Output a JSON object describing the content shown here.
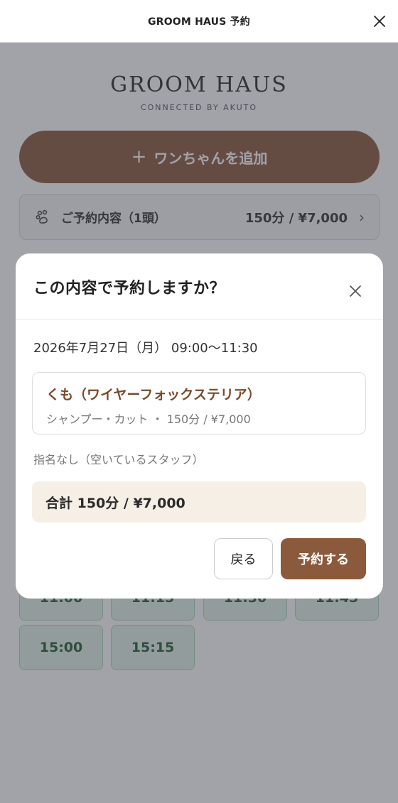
{
  "header": {
    "title": "GROOM HAUS 予約",
    "close_icon": "close-icon"
  },
  "brand": {
    "name": "GROOM HAUS",
    "subtitle": "CONNECTED BY AKUTO"
  },
  "add_dog": {
    "plus": "+",
    "label": "ワンちゃんを追加"
  },
  "summary": {
    "icon": "paw-icon",
    "label": "ご予約内容（1頭）",
    "value": "150分 / ¥7,000",
    "chevron": "›"
  },
  "time_slots": {
    "partial": [
      "11:00",
      "11:15",
      "11:30",
      "11:45"
    ],
    "visible": [
      "15:00",
      "15:15"
    ]
  },
  "modal": {
    "title": "この内容で予約しますか？",
    "datetime": "2026年7月27日（月） 09:00〜11:30",
    "pet": {
      "name": "くも（ワイヤーフォックステリア）",
      "detail": "シャンプー・カット ・ 150分 / ¥7,000"
    },
    "staff": "指名なし（空いているスタッフ）",
    "total": "合計 150分 / ¥7,000",
    "back_label": "戻る",
    "confirm_label": "予約する"
  },
  "colors": {
    "accent": "#8b5a3c",
    "slot_bg": "#e3f4e7",
    "slot_text": "#1f5f35",
    "total_bg": "#f6efe6"
  }
}
